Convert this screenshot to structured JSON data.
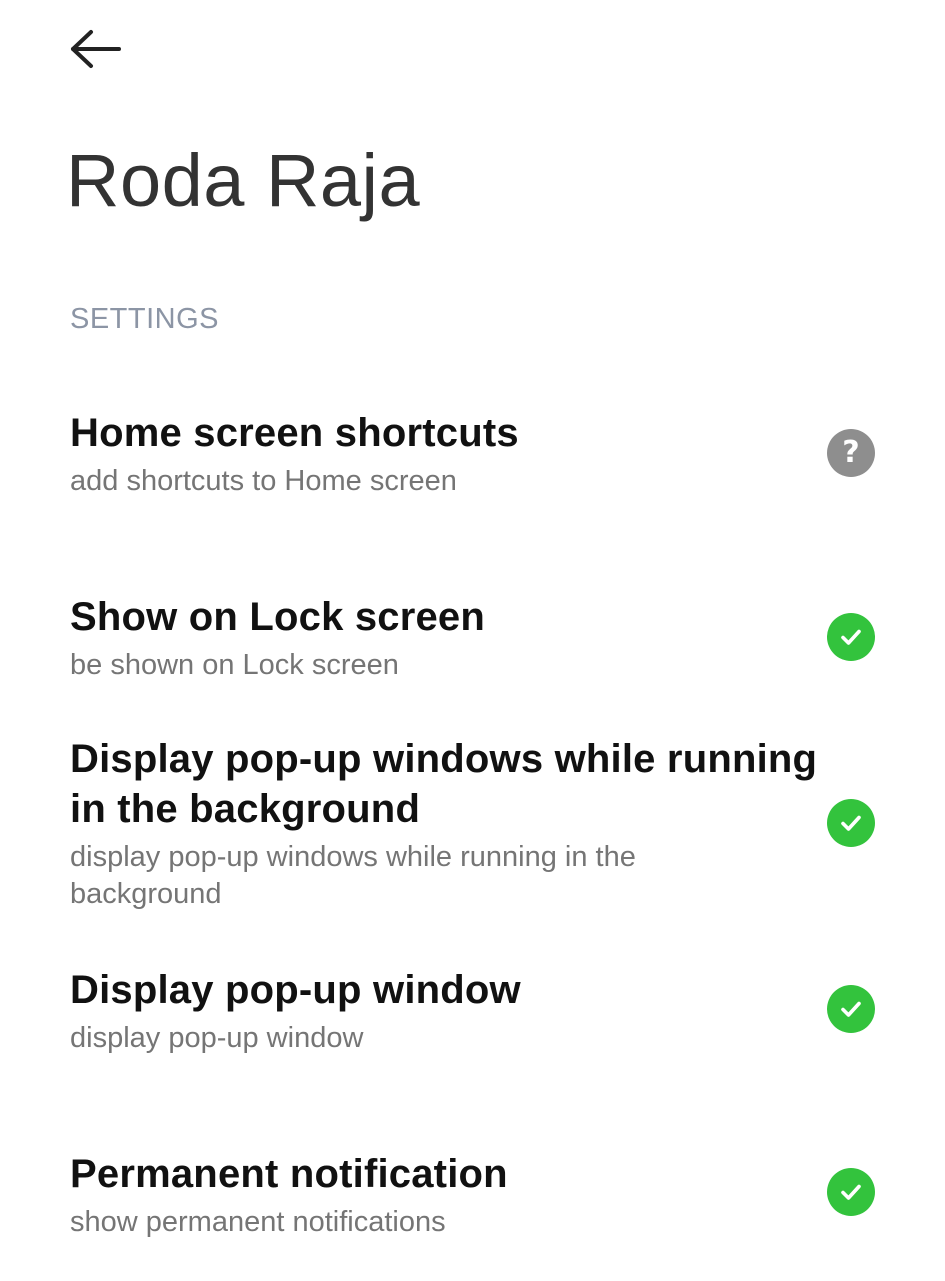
{
  "header": {
    "back_icon": "arrow-left-icon",
    "title": "Roda Raja"
  },
  "section": {
    "label": "SETTINGS"
  },
  "colors": {
    "check_green": "#33c33d",
    "unknown_gray": "#8e8e8e",
    "section_label": "#8c95a5",
    "subtitle": "#757575"
  },
  "settings": [
    {
      "title": "Home screen shortcuts",
      "subtitle": "add shortcuts to Home screen",
      "status": "unknown",
      "status_icon": "question-icon"
    },
    {
      "title": "Show on Lock screen",
      "subtitle": "be shown on Lock screen",
      "status": "allowed",
      "status_icon": "check-circle-icon"
    },
    {
      "title": "Display pop-up windows while running in the background",
      "subtitle": "display pop-up windows while running in the background",
      "status": "allowed",
      "status_icon": "check-circle-icon"
    },
    {
      "title": "Display pop-up window",
      "subtitle": "display pop-up window",
      "status": "allowed",
      "status_icon": "check-circle-icon"
    },
    {
      "title": "Permanent notification",
      "subtitle": "show permanent notifications",
      "status": "allowed",
      "status_icon": "check-circle-icon"
    }
  ]
}
